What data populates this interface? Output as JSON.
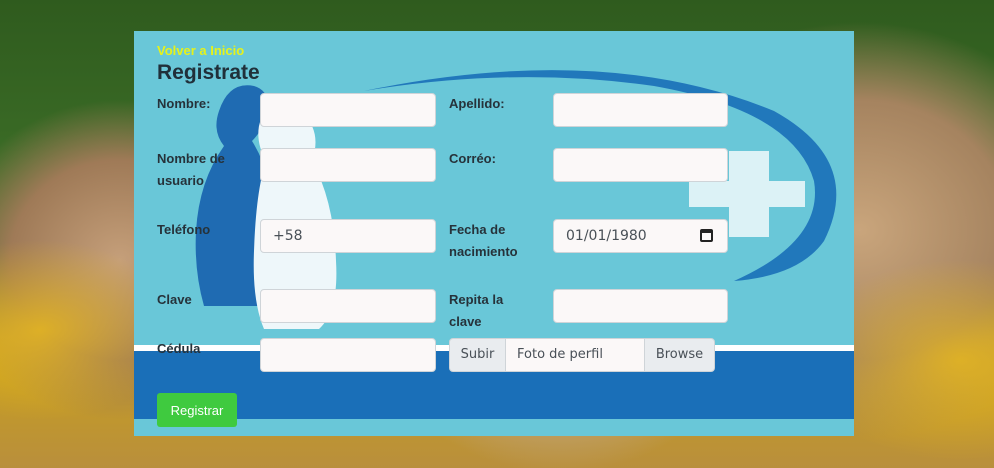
{
  "nav": {
    "back_link": "Volver a Inicio"
  },
  "form": {
    "title": "Registrate",
    "fields": {
      "nombre": {
        "label": "Nombre:",
        "value": ""
      },
      "apellido": {
        "label": "Apellido:",
        "value": ""
      },
      "usuario": {
        "label_line1": "Nombre de",
        "label_line2": "usuario",
        "value": ""
      },
      "correo": {
        "label": "Corréo:",
        "value": ""
      },
      "telefono": {
        "label": "Teléfono",
        "value": "+58"
      },
      "fecha": {
        "label_line1": "Fecha de",
        "label_line2": "nacimiento",
        "value": "01/01/1980"
      },
      "clave": {
        "label": "Clave",
        "value": ""
      },
      "repita": {
        "label_line1": "Repita la",
        "label_line2": "clave",
        "value": ""
      },
      "cedula": {
        "label": "Cédula",
        "value": ""
      }
    },
    "file": {
      "prefix": "Subir",
      "placeholder": "Foto de perfil",
      "button": "Browse"
    },
    "submit_label": "Registrar"
  },
  "colors": {
    "card_bg": "#69c7d8",
    "accent_blue": "#1a6fb8",
    "link_yellow": "#e6f21a",
    "submit_green": "#3fca3f"
  }
}
